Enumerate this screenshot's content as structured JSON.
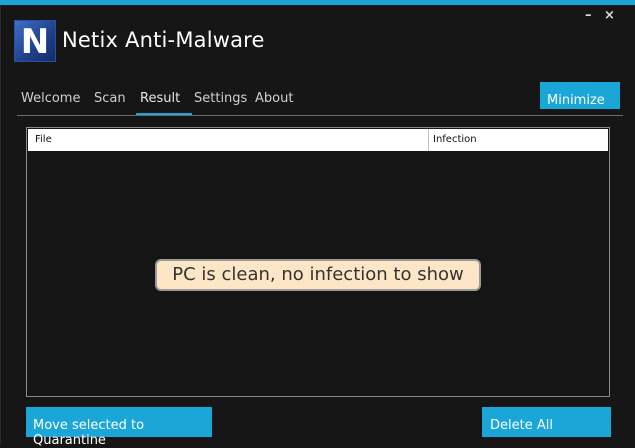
{
  "window": {
    "title": "Netix Anti-Malware",
    "logo_letter": "N",
    "minimize_glyph": "–",
    "close_glyph": "×"
  },
  "tabs": [
    {
      "label": "Welcome",
      "selected": false
    },
    {
      "label": "Scan",
      "selected": false
    },
    {
      "label": "Result",
      "selected": true
    },
    {
      "label": "Settings",
      "selected": false
    },
    {
      "label": "About",
      "selected": false
    }
  ],
  "header": {
    "minimize_label": "Minimize"
  },
  "table": {
    "columns": [
      "File",
      "Infection"
    ],
    "rows": [],
    "empty_message": "PC is clean, no infection to show"
  },
  "actions": {
    "quarantine_label": "Move selected to Quarantine",
    "delete_label": "Delete All"
  },
  "colors": {
    "accent": "#1aa6d6",
    "background": "#161616",
    "empty_message_bg": "#fde6c6"
  }
}
